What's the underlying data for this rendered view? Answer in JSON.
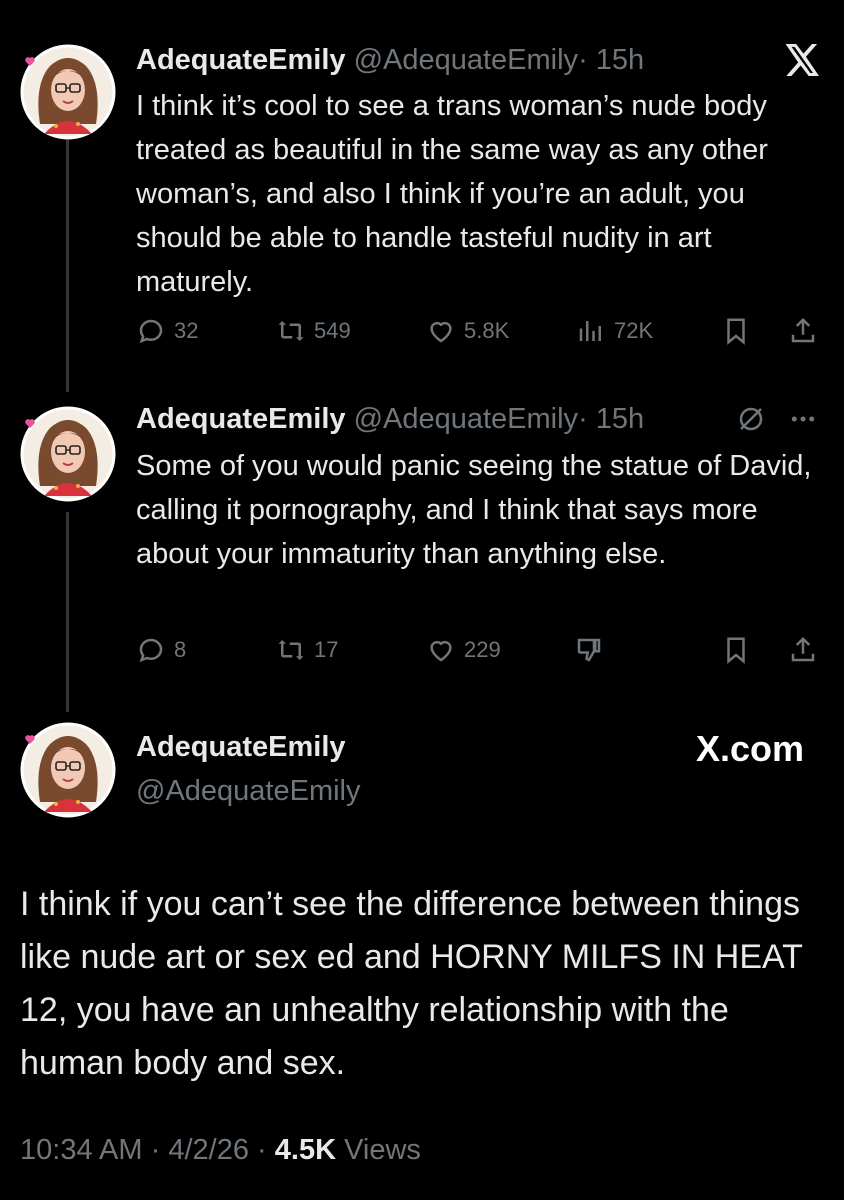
{
  "tweets": [
    {
      "name": "AdequateEmily",
      "handle": "@AdequateEmily",
      "time": "· 15h",
      "text": "I think it’s cool to see a trans woman’s nude body treated as beautiful in the same way as any other woman’s, and also I think if you’re an adult, you should be able to handle tasteful nudity in art maturely.",
      "replies": "32",
      "reposts": "549",
      "likes": "5.8K",
      "views": "72K"
    },
    {
      "name": "AdequateEmily",
      "handle": "@AdequateEmily",
      "time": "· 15h",
      "text": "Some of you would panic seeing the statue of David, calling it pornography, and I think that says more about your immaturity than anything else.",
      "replies": "8",
      "reposts": "17",
      "likes": "229"
    }
  ],
  "main": {
    "name": "AdequateEmily",
    "handle": "@AdequateEmily",
    "brand": "X.com",
    "text": "I think if you can’t see the difference between things like nude art or sex ed and HORNY MILFS IN HEAT 12, you have an unhealthy relationship with the human body and sex.",
    "time": "10:34 AM",
    "date": "4/2/26",
    "views_count": "4.5K",
    "views_label": "Views",
    "sep": "·"
  },
  "icons": {
    "x_logo": "x-logo-icon",
    "grok": "grok-icon",
    "more": "more-icon",
    "reply": "reply-icon",
    "repost": "repost-icon",
    "like": "heart-icon",
    "views": "views-icon",
    "bookmark": "bookmark-icon",
    "share": "share-icon",
    "dislike": "dislike-icon"
  },
  "colors": {
    "background": "#000000",
    "text": "#e7e9ea",
    "muted": "#71767b",
    "thread_line": "#333639"
  }
}
